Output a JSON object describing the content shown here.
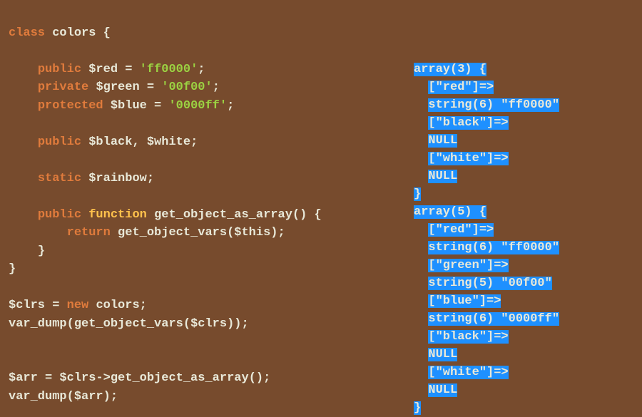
{
  "code": {
    "class_kw": "class",
    "class_name": "colors",
    "open_brace": "{",
    "close_brace": "}",
    "public": "public",
    "private": "private",
    "protected": "protected",
    "static": "static",
    "function": "function",
    "return": "return",
    "new": "new",
    "var_red": "$red",
    "var_green": "$green",
    "var_blue": "$blue",
    "var_black": "$black",
    "var_white": "$white",
    "var_rainbow": "$rainbow",
    "var_this": "$this",
    "var_clrs": "$clrs",
    "var_arr": "$arr",
    "str_red": "'ff0000'",
    "str_green": "'00f00'",
    "str_blue": "'0000ff'",
    "fn_name": "get_object_as_array",
    "fn_getvars": "get_object_vars",
    "fn_vardump": "var_dump",
    "eq": " = ",
    "semi": ";",
    "comma": ", ",
    "arrow": "->",
    "lparen": "(",
    "rparen": ")",
    "empty_paren": "()"
  },
  "output": {
    "l1": "array(3) {",
    "l2": "  [\"red\"]=>",
    "l3": "  string(6) \"ff0000\"",
    "l4": "  [\"black\"]=>",
    "l5": "  NULL",
    "l6": "  [\"white\"]=>",
    "l7": "  NULL",
    "l8": "}",
    "l9": "array(5) {",
    "l10": "  [\"red\"]=>",
    "l11": "  string(6) \"ff0000\"",
    "l12": "  [\"green\"]=>",
    "l13": "  string(5) \"00f00\"",
    "l14": "  [\"blue\"]=>",
    "l15": "  string(6) \"0000ff\"",
    "l16": "  [\"black\"]=>",
    "l17": "  NULL",
    "l18": "  [\"white\"]=>",
    "l19": "  NULL",
    "l20": "}"
  }
}
